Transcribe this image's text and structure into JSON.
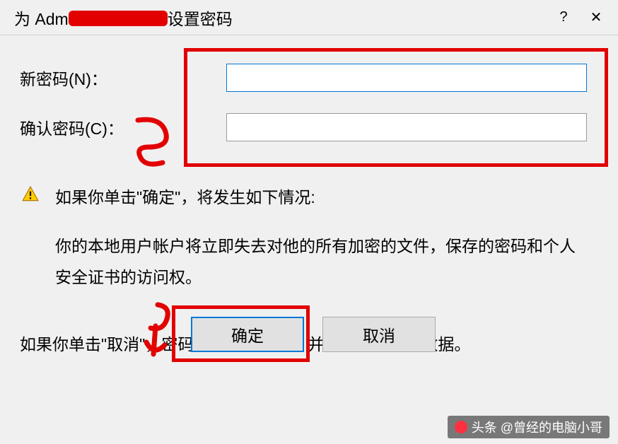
{
  "titlebar": {
    "prefix": "为 Adm",
    "suffix": "设置密码",
    "help": "?",
    "close": "✕"
  },
  "fields": {
    "new_password_label": "新密码(N)：",
    "new_password_value": "",
    "confirm_password_label": "确认密码(C)：",
    "confirm_password_value": ""
  },
  "warning": {
    "headline": "如果你单击\"确定\"，将发生如下情况:",
    "detail": "你的本地用户帐户将立即失去对他的所有加密的文件，保存的密码和个人安全证书的访问权。"
  },
  "cancel_note": "如果你单击\"取消\"，密码将不会被更改，并且将不会丢失数据。",
  "buttons": {
    "ok": "确定",
    "cancel": "取消"
  },
  "watermark": "头条 @曾经的电脑小哥",
  "annotation_colors": {
    "highlight_box": "#e20000"
  }
}
